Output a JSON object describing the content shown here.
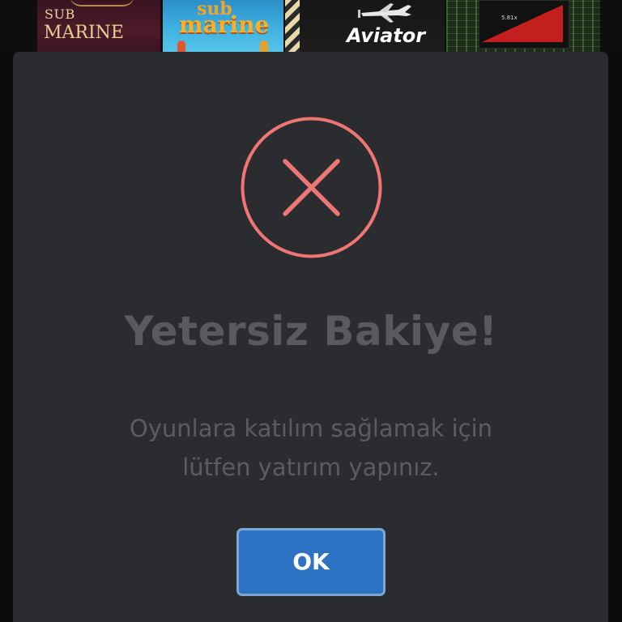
{
  "background_tiles": [
    {
      "small": "SUB",
      "big": "MARINE"
    },
    {
      "small": "sub",
      "big": "marine"
    },
    {
      "big": "Aviator"
    },
    {
      "multiplier": "5.81x"
    }
  ],
  "dialog": {
    "icon": "x-circle-icon",
    "title": "Yetersiz Bakiye!",
    "message_line_1": "Oyunlara katılım sağlamak için",
    "message_line_2": "lütfen yatırım yapınız.",
    "ok_label": "OK"
  },
  "colors": {
    "icon": "#f07575",
    "button": "#2d73c3",
    "modal_bg": "#2b2c2f"
  }
}
